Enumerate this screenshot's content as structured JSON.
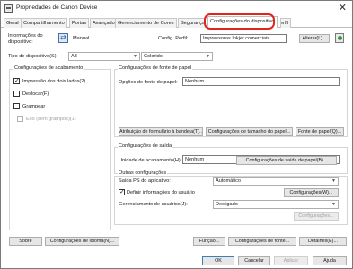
{
  "window": {
    "title": "Propriedades de Canon Device",
    "close_glyph": "✕"
  },
  "tabs": [
    "Geral",
    "Compartilhamento",
    "Portas",
    "Avançado",
    "Gerenciamento de Cores",
    "Segurança",
    "Configurações do dispositivo",
    "Perfil"
  ],
  "active_tab": "Configurações do dispositivo",
  "highlight_color": "#e0261b",
  "device_info": {
    "label": "Informações do dispositivo:",
    "mode": "Manual",
    "config_profile_label": "Config. Perfil:",
    "config_profile_value": "Impressoras Inkjet comerciais",
    "change_button": "Alterar(L)..."
  },
  "device_type": {
    "label": "Tipo de dispositivo(S):",
    "value1": "A3",
    "value2": "Colorido"
  },
  "finishing": {
    "title": "Configurações de acabamento",
    "options": [
      {
        "label": "Impressão dos dois lados(2)",
        "checked": true,
        "enabled": true
      },
      {
        "label": "Deslocar(F)",
        "checked": false,
        "enabled": true
      },
      {
        "label": "Grampear",
        "checked": false,
        "enabled": true
      },
      {
        "label": "Eco (sem grampos)(1)",
        "checked": false,
        "enabled": false
      }
    ]
  },
  "paper_source": {
    "title": "Configurações de fonte de papel",
    "option_label": "Opções de fonte de papel:",
    "option_value": "Nenhum",
    "buttons": [
      "Atribuição de formulário à bandeja(T)...",
      "Configurações de tamanho do papel...",
      "Fonte de papel(Q)..."
    ]
  },
  "output": {
    "title": "Configurações de saída",
    "unit_label": "Unidade de acabamento(H):",
    "unit_value": "Nenhum",
    "button": "Configurações de saída de papel(B)..."
  },
  "other": {
    "title": "Outras configurações",
    "ps_label": "Saída PS do aplicativo:",
    "ps_value": "Automático",
    "user_info_label": "Definir informações do usuário",
    "user_info_checked": true,
    "user_info_button": "Configurações(W)...",
    "user_mgmt_label": "Gerenciamento de usuários(J):",
    "user_mgmt_value": "Desligado",
    "user_mgmt_button": "Configurações..."
  },
  "bottom_buttons": [
    "Sobre",
    "Configurações de idioma(N)...",
    "Função...",
    "Configurações de fonte...",
    "Detalhes(E)..."
  ],
  "dialog_buttons": {
    "ok": "OK",
    "cancel": "Cancelar",
    "apply": "Aplicar",
    "help": "Ajuda"
  }
}
